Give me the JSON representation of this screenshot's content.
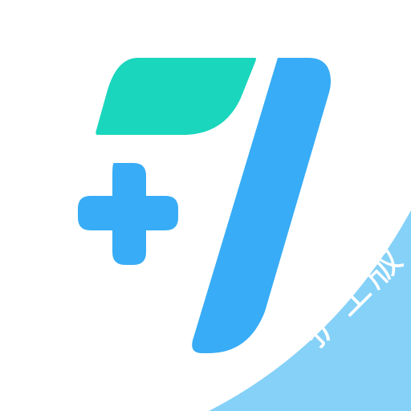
{
  "app_icon": {
    "corner_badge_text": "护士版",
    "colors": {
      "background": "#ffffff",
      "teal_leaf": "#19d6bd",
      "blue_plus": "#38acf6",
      "blue_stroke": "#38acf6",
      "corner_band": "#85d1f8",
      "corner_text": "#ffffff"
    },
    "shapes": [
      "teal-leaf-shape",
      "blue-plus-icon",
      "blue-seven-stroke",
      "corner-ribbon"
    ]
  }
}
